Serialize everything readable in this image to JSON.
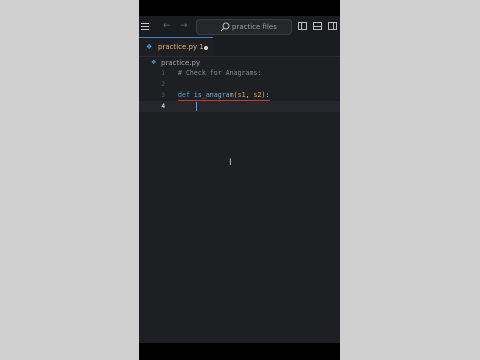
{
  "colors": {
    "editor_bg": "#1e1f22",
    "accent_tab": "#3b82c4",
    "tab_label": "#e2b36b",
    "keyword": "#5b9bd5",
    "param": "#e8a75a",
    "error_underline": "#c23b3b"
  },
  "titlebar": {
    "menu_icon": "hamburger-icon",
    "back_icon": "arrow-left-icon",
    "forward_icon": "arrow-right-icon",
    "search_text": "practice files",
    "layout_icons": [
      "toggle-primary-sidebar-icon",
      "toggle-panel-icon",
      "toggle-secondary-sidebar-icon"
    ]
  },
  "tab": {
    "label": "practice.py 1",
    "icon": "python-file-icon",
    "unsaved": true
  },
  "breadcrumb": {
    "file": "practice.py"
  },
  "editor": {
    "current_line": 4,
    "lines": [
      {
        "number": "1",
        "text": "# Check for Anagrams:"
      },
      {
        "number": "2",
        "text": ""
      },
      {
        "number": "3",
        "text": "def is_anagram(s1, s2):"
      },
      {
        "number": "4",
        "text": ""
      }
    ],
    "line3_tokens": {
      "kw": "def",
      "fn": "is_anagram",
      "open": "(",
      "p1": "s1",
      "sep": ", ",
      "p2": "s2",
      "close": ")",
      "colon": ":"
    }
  }
}
